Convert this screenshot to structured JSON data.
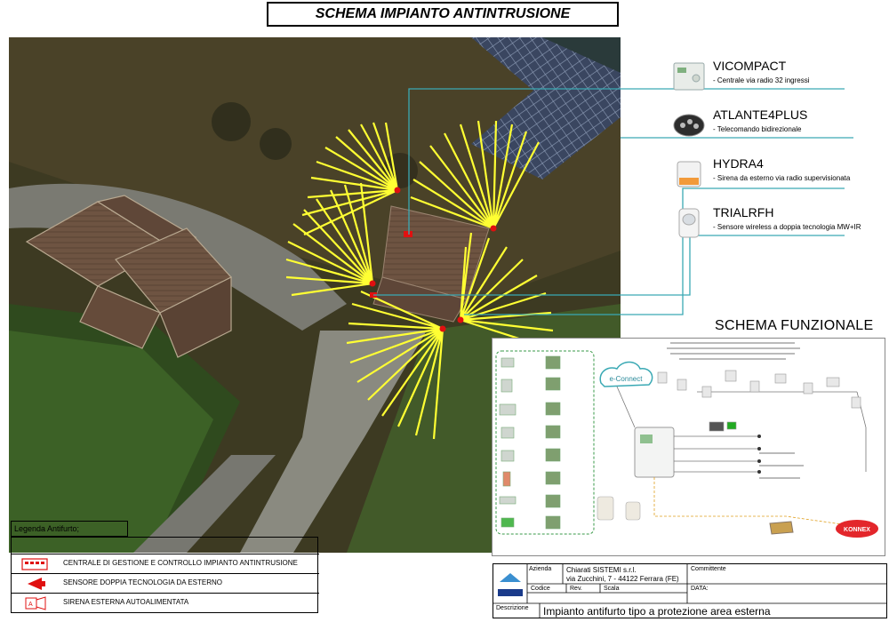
{
  "title": "SCHEMA IMPIANTO ANTINTRUSIONE",
  "devices": [
    {
      "name": "VICOMPACT",
      "desc": "- Centrale via radio 32 ingressi",
      "icon": "control-panel-icon"
    },
    {
      "name": "ATLANTE4PLUS",
      "desc": "- Telecomando bidirezionale",
      "icon": "remote-control-icon"
    },
    {
      "name": "HYDRA4",
      "desc": "- Sirena da esterno via radio supervisionata",
      "icon": "siren-icon"
    },
    {
      "name": "TRIALRFH",
      "desc": "- Sensore wireless a doppia tecnologia MW+IR",
      "icon": "motion-sensor-icon"
    }
  ],
  "schema_funzionale": {
    "title": "SCHEMA FUNZIONALE",
    "econnect": "e-Connect",
    "konnex": "KONNEX"
  },
  "legend": {
    "header": "Legenda Antifurto;",
    "items": [
      {
        "label": "CENTRALE DI GESTIONE E CONTROLLO IMPIANTO ANTINTRUSIONE"
      },
      {
        "label": "SENSORE DOPPIA TECNOLOGIA DA ESTERNO"
      },
      {
        "label": "SIRENA ESTERNA AUTOALIMENTATA"
      }
    ]
  },
  "title_block": {
    "azienda_label": "Azienda",
    "company": "Chiarati SISTEMI s.r.l.",
    "address": "via Zucchini, 7 - 44122 Ferrara (FE)",
    "committente_label": "Committente",
    "codice_label": "Codice",
    "rev_label": "Rev.",
    "scala_label": "Scala",
    "data_label": "DATA:",
    "descrizione_label": "Descrizione",
    "description": "Impianto antifurto tipo a protezione area esterna",
    "logo_text": "CHIARATI SISTEMI"
  },
  "colors": {
    "accent_line": "#3aa9b4",
    "detection_fan": "#ffff33",
    "sensor_marker": "#e01010",
    "konnex_red": "#e3262b"
  }
}
